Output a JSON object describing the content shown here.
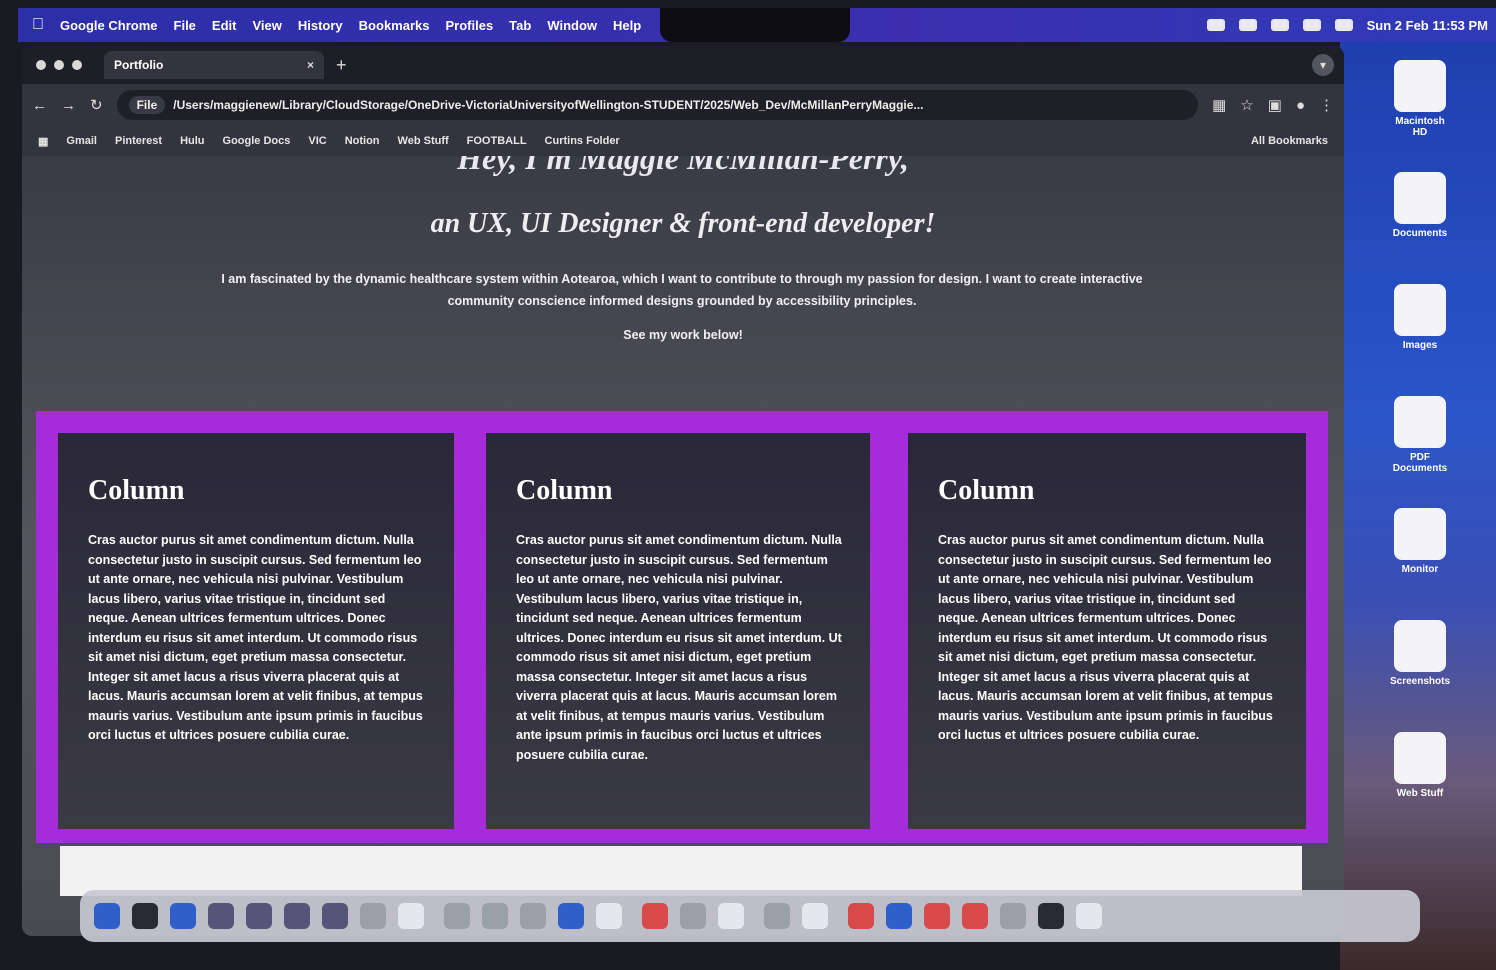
{
  "menubar": {
    "app": "Google Chrome",
    "items": [
      "File",
      "Edit",
      "View",
      "History",
      "Bookmarks",
      "Profiles",
      "Tab",
      "Window",
      "Help"
    ],
    "datetime": "Sun 2 Feb 11:53 PM"
  },
  "desktop": {
    "icons": [
      "Macintosh HD",
      "Documents",
      "Images",
      "PDF Documents",
      "Monitor",
      "Screenshots",
      "Web Stuff"
    ]
  },
  "browser": {
    "tab_title": "Portfolio",
    "tab_close": "×",
    "new_tab": "+",
    "address": "/Users/maggienew/Library/CloudStorage/OneDrive-VictoriaUniversityofWellington-STUDENT/2025/Web_Dev/McMillanPerryMaggie...",
    "address_scheme": "File",
    "bookmarks": [
      "Gmail",
      "Pinterest",
      "Hulu",
      "Google Docs",
      "VIC",
      "Notion",
      "Web Stuff",
      "FOOTBALL",
      "Curtins Folder"
    ],
    "all_bookmarks": "All Bookmarks"
  },
  "page": {
    "heading_partial": "Hey, I'm Maggie McMillan-Perry,",
    "subtitle": "an UX, UI Designer & front-end developer!",
    "intro": "I am fascinated by the dynamic healthcare system within Aotearoa, which I want to contribute to through my passion for design. I want to create interactive community conscience informed designs grounded by accessibility principles.",
    "cta": "See my work below!",
    "columns": [
      {
        "title": "Column",
        "text": "Cras auctor purus sit amet condimentum dictum. Nulla consectetur justo in suscipit cursus. Sed fermentum leo ut ante ornare, nec vehicula nisi pulvinar. Vestibulum lacus libero, varius vitae tristique in, tincidunt sed neque. Aenean ultrices fermentum ultrices. Donec interdum eu risus sit amet interdum. Ut commodo risus sit amet nisi dictum, eget pretium massa consectetur. Integer sit amet lacus a risus viverra placerat quis at lacus. Mauris accumsan lorem at velit finibus, at tempus mauris varius. Vestibulum ante ipsum primis in faucibus orci luctus et ultrices posuere cubilia curae."
      },
      {
        "title": "Column",
        "text": "Cras auctor purus sit amet condimentum dictum. Nulla consectetur justo in suscipit cursus. Sed fermentum leo ut ante ornare, nec vehicula nisi pulvinar. Vestibulum lacus libero, varius vitae tristique in, tincidunt sed neque. Aenean ultrices fermentum ultrices. Donec interdum eu risus sit amet interdum. Ut commodo risus sit amet nisi dictum, eget pretium massa consectetur. Integer sit amet lacus a risus viverra placerat quis at lacus. Mauris accumsan lorem at velit finibus, at tempus mauris varius. Vestibulum ante ipsum primis in faucibus orci luctus et ultrices posuere cubilia curae."
      },
      {
        "title": "Column",
        "text": "Cras auctor purus sit amet condimentum dictum. Nulla consectetur justo in suscipit cursus. Sed fermentum leo ut ante ornare, nec vehicula nisi pulvinar. Vestibulum lacus libero, varius vitae tristique in, tincidunt sed neque. Aenean ultrices fermentum ultrices. Donec interdum eu risus sit amet interdum. Ut commodo risus sit amet nisi dictum, eget pretium massa consectetur. Integer sit amet lacus a risus viverra placerat quis at lacus. Mauris accumsan lorem at velit finibus, at tempus mauris varius. Vestibulum ante ipsum primis in faucibus orci luctus et ultrices posuere cubilia curae."
      }
    ]
  },
  "colors": {
    "accent_purple": "#a52bdb",
    "menubar_blue": "#2b2fa8",
    "card_dark": "#2a2838"
  }
}
